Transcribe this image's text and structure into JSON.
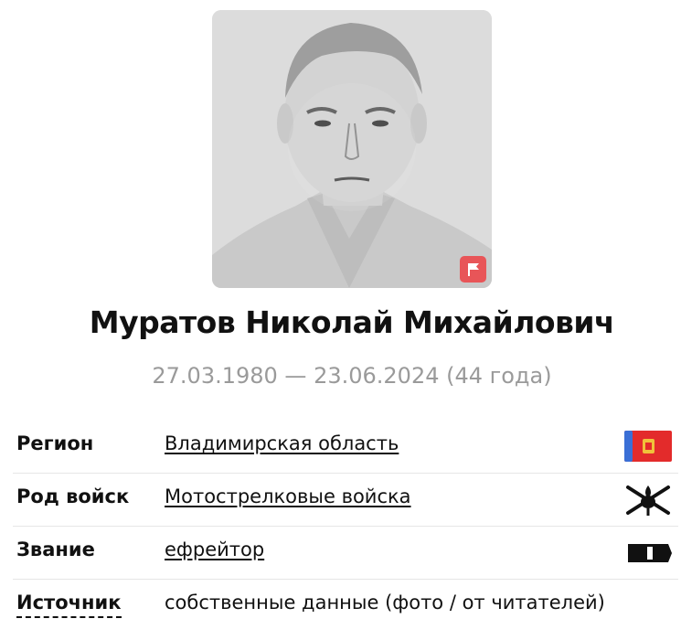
{
  "person": {
    "name": "Муратов Николай Михайлович",
    "dates": "27.03.1980 — 23.06.2024 (44 года)"
  },
  "details": {
    "region": {
      "label": "Регион",
      "value": "Владимирская область",
      "icon": "region-flag-icon"
    },
    "branch": {
      "label": "Род войск",
      "value": "Мотострелковые войска",
      "icon": "motor-rifle-emblem-icon"
    },
    "rank": {
      "label": "Звание",
      "value": "ефрейтор",
      "icon": "rank-stripe-icon"
    },
    "source": {
      "label": "Источник",
      "value": "собственные данные (фото / от читателей)"
    }
  },
  "colors": {
    "badge": "#e85558",
    "dates_text": "#9a9a9a",
    "region_flag_red": "#e32b2b",
    "region_flag_blue": "#3a6fd6"
  }
}
